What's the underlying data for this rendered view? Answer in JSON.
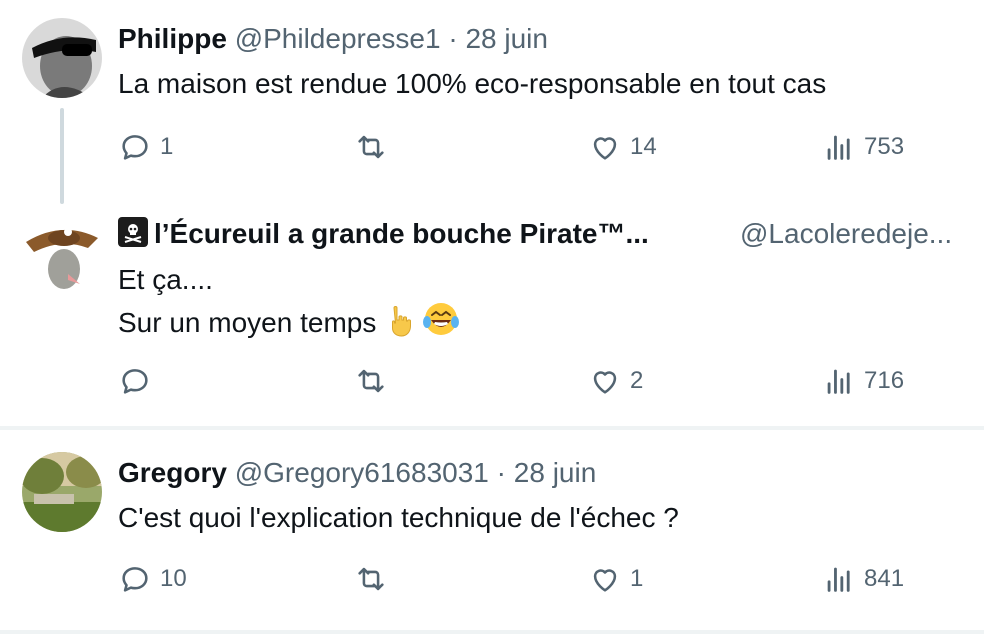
{
  "tweets": [
    {
      "name": "Philippe",
      "handle": "@Phildepresse1",
      "dot": "·",
      "date": "28 juin",
      "lines": [
        "La maison est rendue 100% eco-responsable en tout cas"
      ],
      "replies": "1",
      "retweets": "",
      "likes": "14",
      "views": "753"
    },
    {
      "name": "l’Écureuil a grande bouche Pirate™...",
      "handle": "@Lacoleredeje...",
      "lines": [
        "Et ça....",
        "Sur un moyen temps"
      ],
      "replies": "",
      "retweets": "",
      "likes": "2",
      "views": "716"
    },
    {
      "name": "Gregory",
      "handle": "@Gregory61683031",
      "dot": "·",
      "date": "28 juin",
      "lines": [
        "C'est quoi l'explication technique de l'échec ?"
      ],
      "replies": "10",
      "retweets": "",
      "likes": "1",
      "views": "841"
    }
  ],
  "colors": {
    "text": "#0f1419",
    "secondary": "#536471",
    "separator": "#eff3f4",
    "thread": "#cfd9de"
  }
}
